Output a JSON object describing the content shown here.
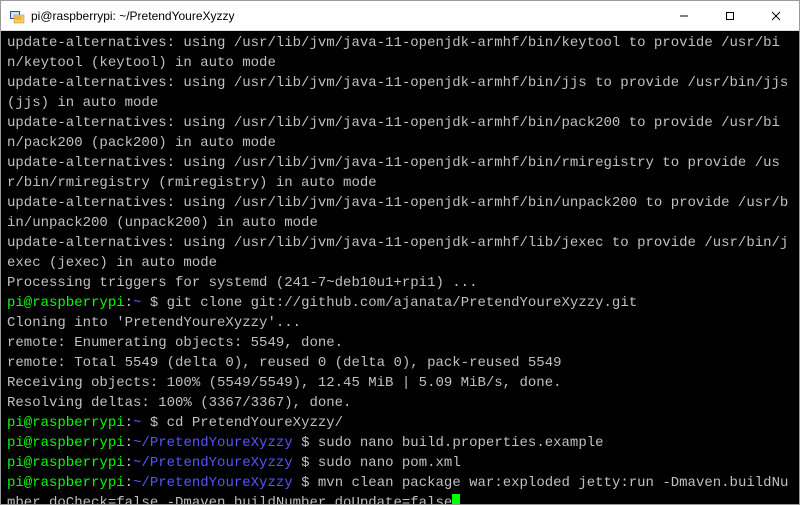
{
  "window": {
    "title": "pi@raspberrypi: ~/PretendYoureXyzzy",
    "icon": "putty-icon"
  },
  "controls": {
    "minimize": "minimize",
    "maximize": "maximize",
    "close": "close"
  },
  "lines": [
    {
      "t": "out",
      "text": "update-alternatives: using /usr/lib/jvm/java-11-openjdk-armhf/bin/keytool to provide /usr/bin/keytool (keytool) in auto mode"
    },
    {
      "t": "out",
      "text": "update-alternatives: using /usr/lib/jvm/java-11-openjdk-armhf/bin/jjs to provide /usr/bin/jjs (jjs) in auto mode"
    },
    {
      "t": "out",
      "text": "update-alternatives: using /usr/lib/jvm/java-11-openjdk-armhf/bin/pack200 to provide /usr/bin/pack200 (pack200) in auto mode"
    },
    {
      "t": "out",
      "text": "update-alternatives: using /usr/lib/jvm/java-11-openjdk-armhf/bin/rmiregistry to provide /usr/bin/rmiregistry (rmiregistry) in auto mode"
    },
    {
      "t": "out",
      "text": "update-alternatives: using /usr/lib/jvm/java-11-openjdk-armhf/bin/unpack200 to provide /usr/bin/unpack200 (unpack200) in auto mode"
    },
    {
      "t": "out",
      "text": "update-alternatives: using /usr/lib/jvm/java-11-openjdk-armhf/lib/jexec to provide /usr/bin/jexec (jexec) in auto mode"
    },
    {
      "t": "out",
      "text": "Processing triggers for systemd (241-7~deb10u1+rpi1) ..."
    },
    {
      "t": "prompt",
      "user": "pi@raspberrypi",
      "path": "~",
      "sym": "$",
      "cmd": "git clone git://github.com/ajanata/PretendYoureXyzzy.git"
    },
    {
      "t": "out",
      "text": "Cloning into 'PretendYoureXyzzy'..."
    },
    {
      "t": "out",
      "text": "remote: Enumerating objects: 5549, done."
    },
    {
      "t": "out",
      "text": "remote: Total 5549 (delta 0), reused 0 (delta 0), pack-reused 5549"
    },
    {
      "t": "out",
      "text": "Receiving objects: 100% (5549/5549), 12.45 MiB | 5.09 MiB/s, done."
    },
    {
      "t": "out",
      "text": "Resolving deltas: 100% (3367/3367), done."
    },
    {
      "t": "prompt",
      "user": "pi@raspberrypi",
      "path": "~",
      "sym": "$",
      "cmd": "cd PretendYoureXyzzy/"
    },
    {
      "t": "prompt",
      "user": "pi@raspberrypi",
      "path": "~/PretendYoureXyzzy",
      "sym": "$",
      "cmd": "sudo nano build.properties.example"
    },
    {
      "t": "prompt",
      "user": "pi@raspberrypi",
      "path": "~/PretendYoureXyzzy",
      "sym": "$",
      "cmd": "sudo nano pom.xml"
    },
    {
      "t": "prompt",
      "user": "pi@raspberrypi",
      "path": "~/PretendYoureXyzzy",
      "sym": "$",
      "cmd": "mvn clean package war:exploded jetty:run -Dmaven.buildNumber.doCheck=false -Dmaven.buildNumber.doUpdate=false",
      "cursor": true
    }
  ]
}
